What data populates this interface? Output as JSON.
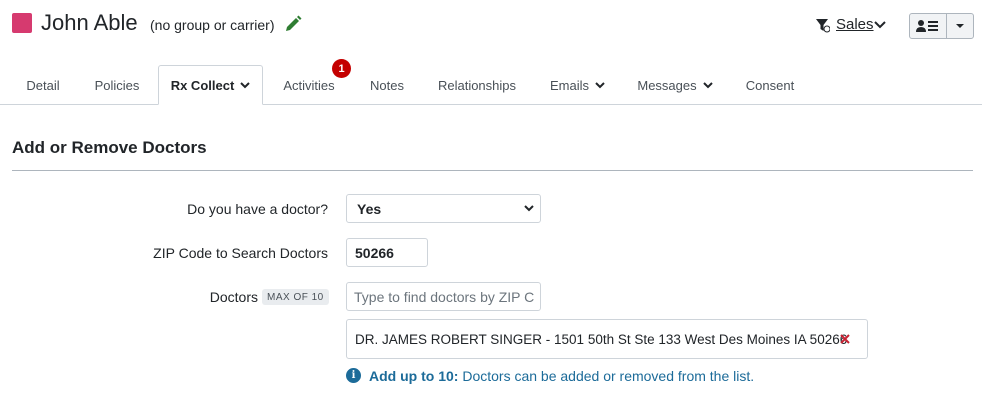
{
  "header": {
    "contact_name": "John Able",
    "contact_subtitle": "(no group or carrier)",
    "color": "#d63a6f",
    "sales_label": "Sales"
  },
  "tabs": [
    {
      "label": "Detail"
    },
    {
      "label": "Policies"
    },
    {
      "label": "Rx Collect",
      "active": true,
      "dropdown": true
    },
    {
      "label": "Activities",
      "badge": "1"
    },
    {
      "label": "Notes"
    },
    {
      "label": "Relationships"
    },
    {
      "label": "Emails",
      "dropdown": true
    },
    {
      "label": "Messages",
      "dropdown": true
    },
    {
      "label": "Consent"
    }
  ],
  "section": {
    "title": "Add or Remove Doctors"
  },
  "form": {
    "have_doctor_label": "Do you have a doctor?",
    "have_doctor_value": "Yes",
    "zip_label": "ZIP Code to Search Doctors",
    "zip_value": "50266",
    "doctors_label": "Doctors",
    "doctors_max_badge": "MAX OF 10",
    "doctor_search_placeholder": "Type to find doctors by ZIP C",
    "selected_doctors": [
      "DR. JAMES ROBERT SINGER - 1501 50th St Ste 133 West Des Moines IA 50266"
    ],
    "hint_bold": "Add up to 10:",
    "hint_text": "Doctors can be added or removed from the list."
  }
}
